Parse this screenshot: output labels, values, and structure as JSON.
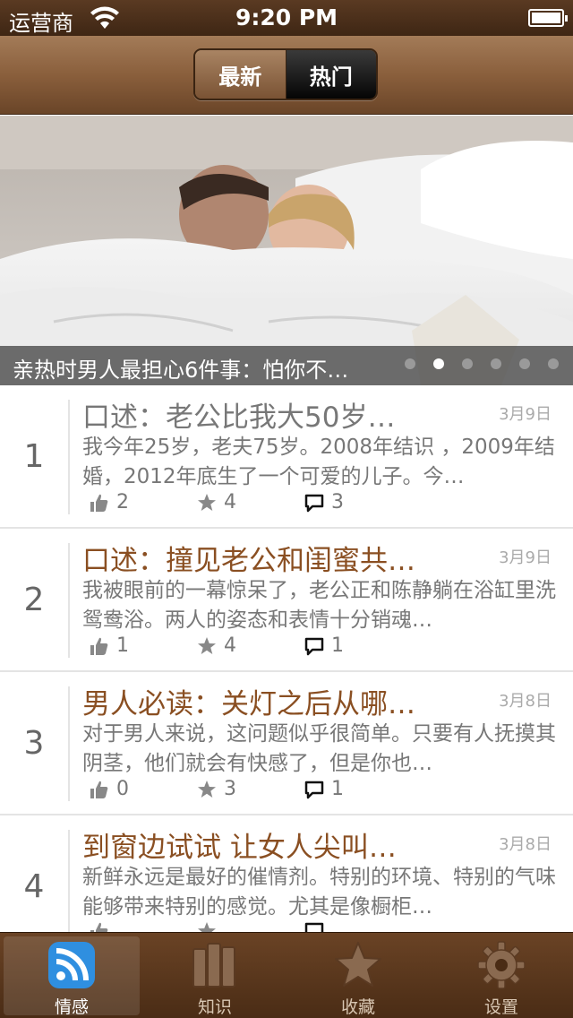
{
  "status_bar": {
    "carrier": "运营商",
    "time": "9:20 PM"
  },
  "nav": {
    "segments": [
      "最新",
      "热门"
    ],
    "selected": "热门"
  },
  "banner": {
    "caption": "亲热时男人最担心6件事：怕你不…",
    "page_count": 6,
    "current_page": 2
  },
  "articles": [
    {
      "rank": "1",
      "title": "口述：老公比我大50岁…",
      "title_color": "#777777",
      "date": "3月9日",
      "summary": "我今年25岁，老夫75岁。2008年结识 ，2009年结婚，2012年底生了一个可爱的儿子。今…",
      "likes": "2",
      "favorites": "4",
      "comments": "3"
    },
    {
      "rank": "2",
      "title": "口述：撞见老公和闺蜜共…",
      "title_color": "#8a4f22",
      "date": "3月9日",
      "summary": "我被眼前的一幕惊呆了，老公正和陈静躺在浴缸里洗鸳鸯浴。两人的姿态和表情十分销魂…",
      "likes": "1",
      "favorites": "4",
      "comments": "1"
    },
    {
      "rank": "3",
      "title": "男人必读：关灯之后从哪…",
      "title_color": "#8a4f22",
      "date": "3月8日",
      "summary": "对于男人来说，这问题似乎很简单。只要有人抚摸其阴茎，他们就会有快感了，但是你也…",
      "likes": "0",
      "favorites": "3",
      "comments": "1"
    },
    {
      "rank": "4",
      "title": "到窗边试试 让女人尖叫…",
      "title_color": "#8a4f22",
      "date": "3月8日",
      "summary": "新鲜永远是最好的催情剂。特别的环境、特别的气味能够带来特别的感觉。尤其是像橱柜…",
      "likes": "",
      "favorites": "",
      "comments": ""
    }
  ],
  "tabs": [
    {
      "label": "情感",
      "icon": "rss-icon",
      "active": true
    },
    {
      "label": "知识",
      "icon": "books-icon",
      "active": false
    },
    {
      "label": "收藏",
      "icon": "star-icon",
      "active": false
    },
    {
      "label": "设置",
      "icon": "gear-icon",
      "active": false
    }
  ],
  "colors": {
    "accent_brown": "#8a4f22",
    "tab_active_blue": "#3a9ee8"
  }
}
